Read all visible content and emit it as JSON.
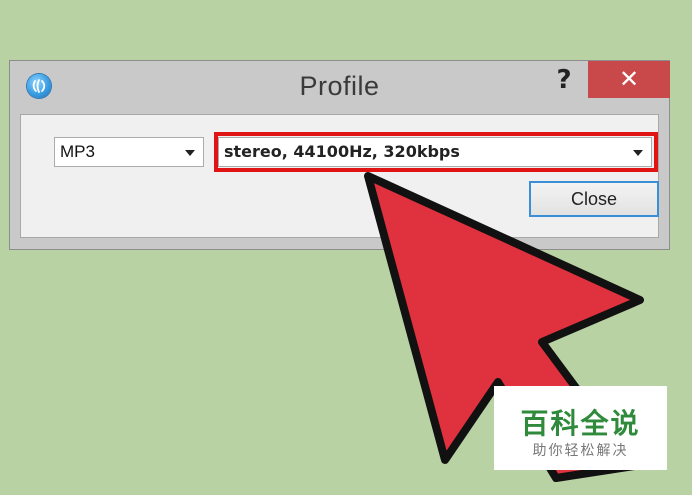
{
  "window": {
    "title": "Profile",
    "help_label": "?",
    "close_x_label": "✕",
    "app_icon": "app-logo-icon"
  },
  "profile": {
    "format_value": "MP3",
    "quality_value": "stereo, 44100Hz, 320kbps",
    "close_label": "Close"
  },
  "overlay": {
    "arrow_color": "#e0313e",
    "highlight_color": "#e01414"
  },
  "watermark": {
    "main": "百科全说",
    "sub": "助你轻松解决"
  }
}
